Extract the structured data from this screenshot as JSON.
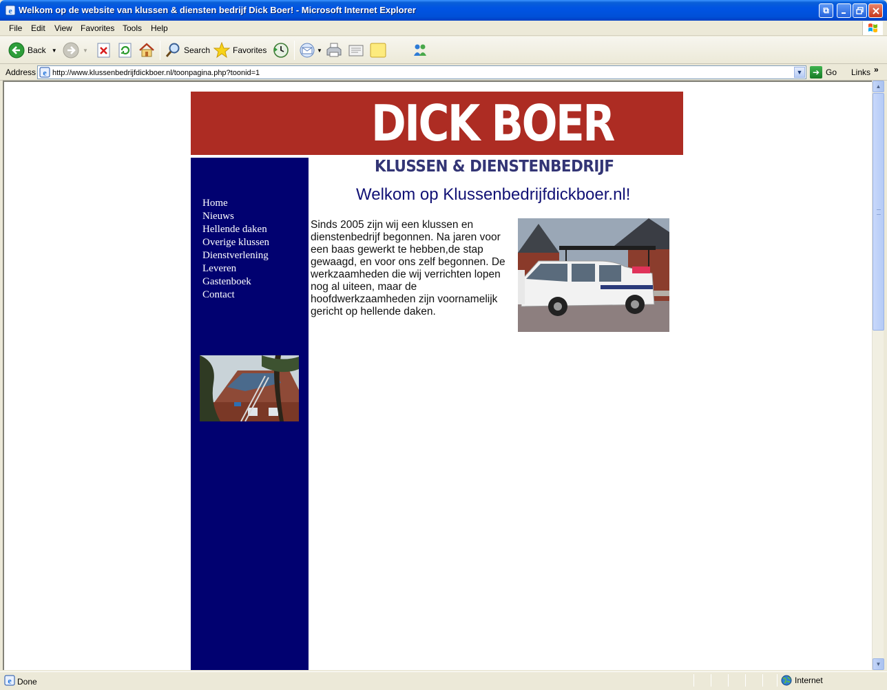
{
  "window": {
    "title": "Welkom op de website van klussen & diensten bedrijf Dick Boer! - Microsoft Internet Explorer"
  },
  "menu": [
    "File",
    "Edit",
    "View",
    "Favorites",
    "Tools",
    "Help"
  ],
  "toolbar": {
    "back": "Back",
    "search": "Search",
    "favorites": "Favorites"
  },
  "address": {
    "label": "Address",
    "url": "http://www.klussenbedrijfdickboer.nl/toonpagina.php?toonid=1",
    "go": "Go",
    "links": "Links",
    "links_chevron": "»"
  },
  "status": {
    "text": "Done",
    "zone": "Internet"
  },
  "site": {
    "brand": "DICK BOER",
    "tagline": "KLUSSEN & DIENSTENBEDRIJF",
    "nav": [
      "Home",
      "Nieuws",
      "Hellende daken",
      "Overige klussen",
      "Dienstverlening",
      "Leveren",
      "Gastenboek",
      "Contact"
    ],
    "welcome": "Welkom op Klussenbedrijfdickboer.nl!",
    "intro": "Sinds 2005 zijn wij een klussen en dienstenbedrijf begonnen. Na jaren voor een baas gewerkt te hebben,de stap gewaagd, en voor ons zelf begonnen. De werkzaamheden die wij verrichten lopen nog al uiteen, maar de hoofdwerkzaamheden zijn voornamelijk gericht op hellende daken."
  },
  "colors": {
    "header_red": "#ad2c23",
    "nav_blue": "#010170",
    "tagline_blue": "#333575",
    "xp_title_blue": "#0054e3"
  },
  "icons": [
    "ie-app-icon",
    "back-arrow-icon",
    "forward-arrow-icon",
    "stop-icon",
    "refresh-icon",
    "home-icon",
    "search-icon",
    "favorites-star-icon",
    "history-icon",
    "mail-icon",
    "print-icon",
    "edit-icon",
    "discuss-icon",
    "messenger-icon",
    "page-icon",
    "globe-icon"
  ]
}
